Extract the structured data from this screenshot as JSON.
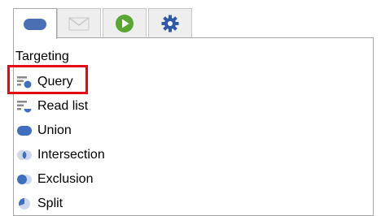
{
  "tabs": [
    {
      "icon": "ellipse-icon",
      "active": true
    },
    {
      "icon": "envelope-icon",
      "active": false
    },
    {
      "icon": "play-circle-icon",
      "active": false
    },
    {
      "icon": "gear-icon",
      "active": false
    }
  ],
  "panel": {
    "section_title": "Targeting",
    "items": [
      {
        "label": "Query",
        "icon": "query-icon"
      },
      {
        "label": "Read list",
        "icon": "read-list-icon"
      },
      {
        "label": "Union",
        "icon": "union-icon"
      },
      {
        "label": "Intersection",
        "icon": "intersection-icon"
      },
      {
        "label": "Exclusion",
        "icon": "exclusion-icon"
      },
      {
        "label": "Split",
        "icon": "split-icon"
      }
    ]
  },
  "colors": {
    "accent_blue": "#3f6fc0",
    "highlight_red": "#e30613",
    "play_green": "#5aa632"
  }
}
